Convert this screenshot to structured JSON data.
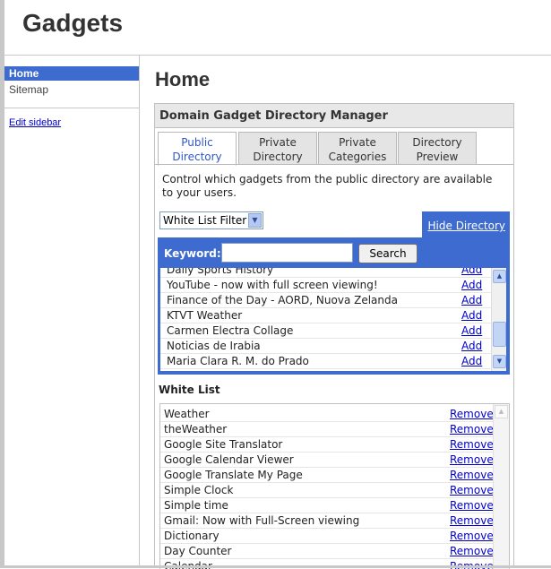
{
  "site": {
    "title": "Gadgets"
  },
  "sidebar": {
    "items": [
      {
        "label": "Home"
      },
      {
        "label": "Sitemap"
      }
    ],
    "edit_link": "Edit sidebar"
  },
  "page": {
    "title": "Home"
  },
  "manager": {
    "title": "Domain Gadget Directory Manager",
    "tabs": [
      {
        "line1": "Public",
        "line2": "Directory"
      },
      {
        "line1": "Private",
        "line2": "Directory"
      },
      {
        "line1": "Private",
        "line2": "Categories"
      },
      {
        "line1": "Directory",
        "line2": "Preview"
      }
    ],
    "description": "Control which gadgets from the public directory are available to your users.",
    "filter_value": "White List Filter",
    "hide_directory": "Hide Directory",
    "keyword_label": "Keyword:",
    "keyword_value": "",
    "search_button": "Search",
    "add_label": "Add",
    "directory_items": [
      "Daily Sports History",
      "YouTube - now with full screen viewing!",
      "Finance of the Day - AORD, Nuova Zelanda",
      "KTVT Weather",
      "Carmen Electra Collage",
      "Noticias de Irabia",
      "Maria Clara R. M. do Prado"
    ],
    "whitelist_title": "White List",
    "remove_label": "Remove",
    "whitelist_items": [
      "Weather",
      "theWeather",
      "Google Site Translator",
      "Google Calendar Viewer",
      "Google Translate My Page",
      "Simple Clock",
      "Simple time",
      "Gmail: Now with Full-Screen viewing",
      "Dictionary",
      "Day Counter",
      "Calendar"
    ]
  },
  "colors": {
    "accent": "#3d6bd0",
    "link": "#0000cc"
  }
}
